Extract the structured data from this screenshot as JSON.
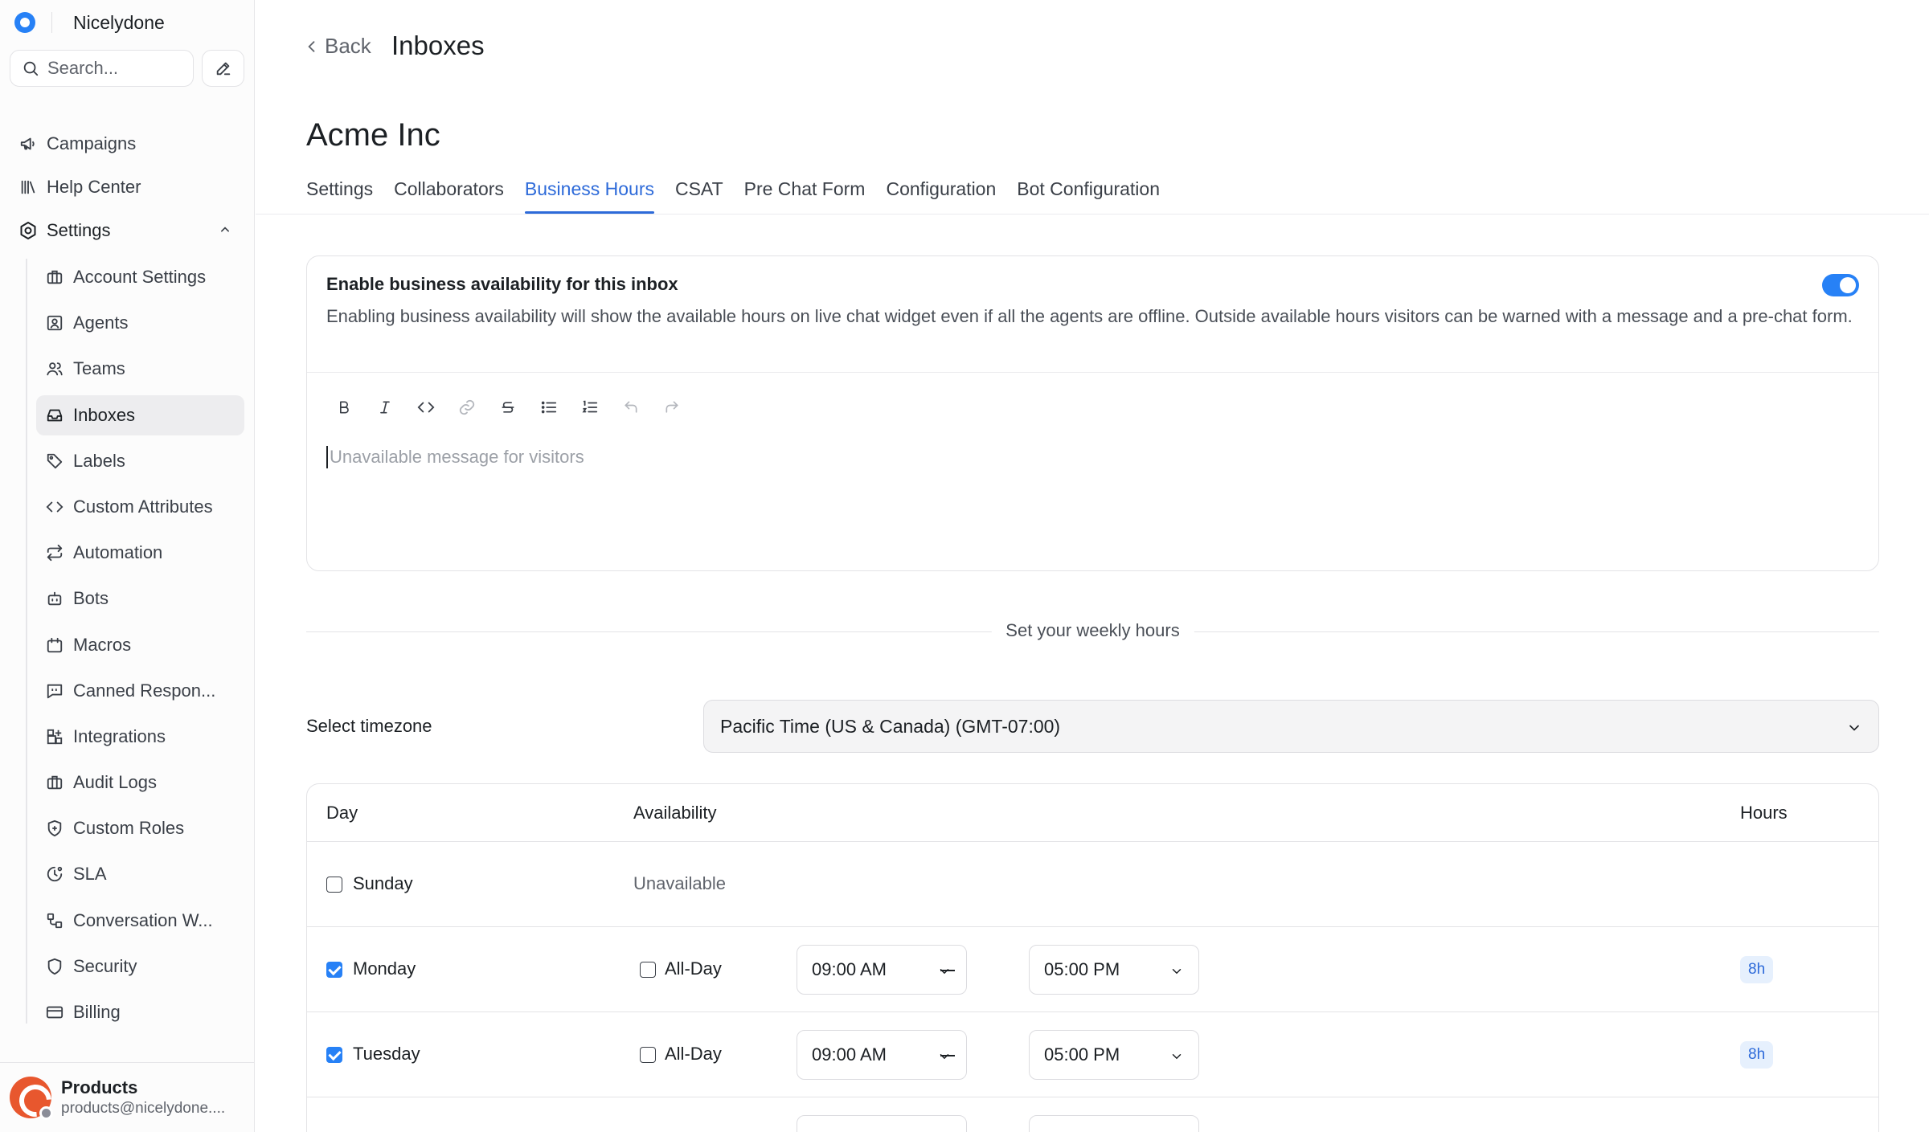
{
  "brand": {
    "name": "Nicelydone"
  },
  "search": {
    "placeholder": "Search..."
  },
  "nav": {
    "top": [
      {
        "label": "Campaigns",
        "icon": "megaphone-icon"
      },
      {
        "label": "Help Center",
        "icon": "library-icon"
      },
      {
        "label": "Settings",
        "icon": "gear-icon"
      }
    ],
    "settings": [
      {
        "label": "Account Settings",
        "icon": "briefcase-icon"
      },
      {
        "label": "Agents",
        "icon": "user-square-icon"
      },
      {
        "label": "Teams",
        "icon": "users-icon"
      },
      {
        "label": "Inboxes",
        "icon": "inbox-icon"
      },
      {
        "label": "Labels",
        "icon": "tag-icon"
      },
      {
        "label": "Custom Attributes",
        "icon": "code-icon"
      },
      {
        "label": "Automation",
        "icon": "repeat-icon"
      },
      {
        "label": "Bots",
        "icon": "bot-icon"
      },
      {
        "label": "Macros",
        "icon": "calendar-icon"
      },
      {
        "label": "Canned Respon...",
        "icon": "message-square-icon"
      },
      {
        "label": "Integrations",
        "icon": "grid-plus-icon"
      },
      {
        "label": "Audit Logs",
        "icon": "briefcase-icon"
      },
      {
        "label": "Custom Roles",
        "icon": "shield-plus-icon"
      },
      {
        "label": "SLA",
        "icon": "clock-icon"
      },
      {
        "label": "Conversation W...",
        "icon": "workflow-icon"
      },
      {
        "label": "Security",
        "icon": "shield-icon"
      },
      {
        "label": "Billing",
        "icon": "credit-card-icon"
      }
    ],
    "active": "Inboxes"
  },
  "user": {
    "name": "Products",
    "email": "products@nicelydone...."
  },
  "header": {
    "back": "Back",
    "title": "Inboxes"
  },
  "inbox": {
    "name": "Acme Inc"
  },
  "tabs": [
    {
      "label": "Settings"
    },
    {
      "label": "Collaborators"
    },
    {
      "label": "Business Hours"
    },
    {
      "label": "CSAT"
    },
    {
      "label": "Pre Chat Form"
    },
    {
      "label": "Configuration"
    },
    {
      "label": "Bot Configuration"
    }
  ],
  "active_tab": "Business Hours",
  "availability": {
    "title": "Enable business availability for this inbox",
    "description": "Enabling business availability will show the available hours on live chat widget even if all the agents are offline. Outside available hours visitors can be warned with a message and a pre-chat form.",
    "enabled": true,
    "editor_placeholder": "Unavailable message for visitors",
    "toolbar": [
      "bold-icon",
      "italic-icon",
      "code-icon",
      "link-icon",
      "strikethrough-icon",
      "bullet-list-icon",
      "numbered-list-icon",
      "undo-icon",
      "redo-icon"
    ]
  },
  "weekly": {
    "divider_label": "Set your weekly hours"
  },
  "timezone": {
    "label": "Select timezone",
    "value": "Pacific Time (US & Canada) (GMT-07:00)"
  },
  "schedule": {
    "headers": {
      "day": "Day",
      "availability": "Availability",
      "hours": "Hours"
    },
    "unavailable_label": "Unavailable",
    "all_day_label": "All-Day",
    "days": [
      {
        "name": "Sunday",
        "enabled": false,
        "all_day": false,
        "from": "",
        "to": "",
        "hours": ""
      },
      {
        "name": "Monday",
        "enabled": true,
        "all_day": false,
        "from": "09:00 AM",
        "to": "05:00 PM",
        "hours": "8h"
      },
      {
        "name": "Tuesday",
        "enabled": true,
        "all_day": false,
        "from": "09:00 AM",
        "to": "05:00 PM",
        "hours": "8h"
      },
      {
        "name": "",
        "enabled": true,
        "all_day": false,
        "from": "",
        "to": "",
        "hours": ""
      }
    ]
  },
  "colors": {
    "accent": "#2781f6",
    "active_tab": "#2d6ad9",
    "avatar": "#e8572e"
  }
}
